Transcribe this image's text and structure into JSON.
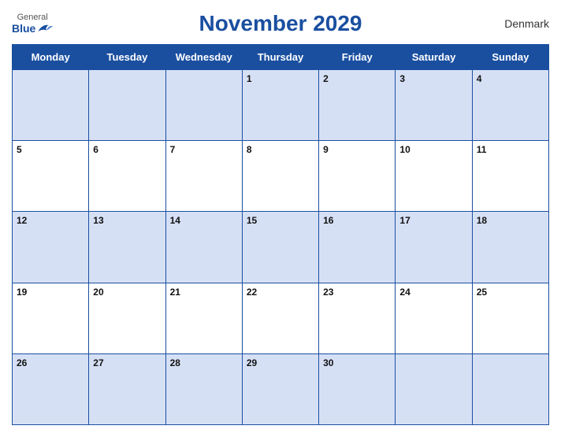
{
  "header": {
    "logo_general": "General",
    "logo_blue": "Blue",
    "title": "November 2029",
    "country": "Denmark"
  },
  "days_of_week": [
    "Monday",
    "Tuesday",
    "Wednesday",
    "Thursday",
    "Friday",
    "Saturday",
    "Sunday"
  ],
  "weeks": [
    [
      "",
      "",
      "",
      "1",
      "2",
      "3",
      "4"
    ],
    [
      "5",
      "6",
      "7",
      "8",
      "9",
      "10",
      "11"
    ],
    [
      "12",
      "13",
      "14",
      "15",
      "16",
      "17",
      "18"
    ],
    [
      "19",
      "20",
      "21",
      "22",
      "23",
      "24",
      "25"
    ],
    [
      "26",
      "27",
      "28",
      "29",
      "30",
      "",
      ""
    ]
  ]
}
